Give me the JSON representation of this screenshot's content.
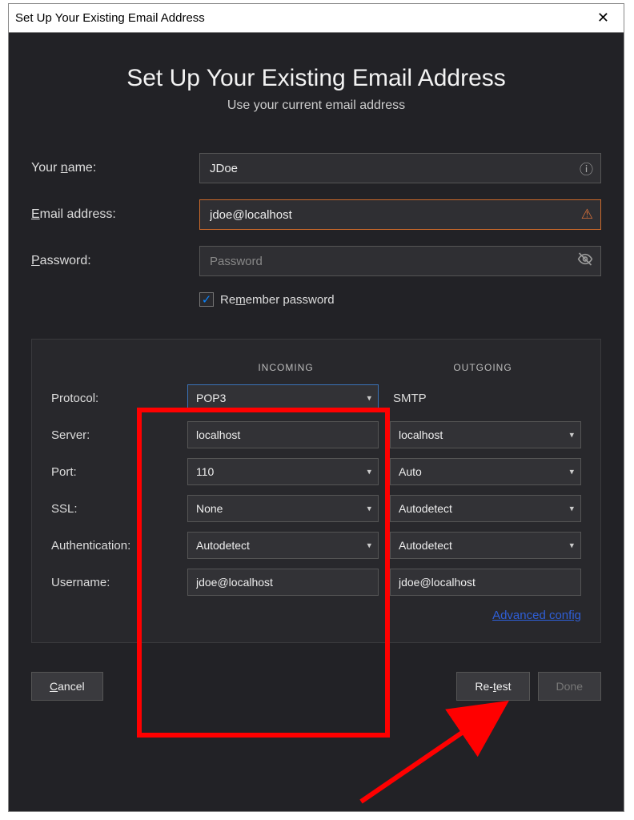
{
  "window": {
    "title": "Set Up Your Existing Email Address"
  },
  "heading": "Set Up Your Existing Email Address",
  "subheading": "Use your current email address",
  "labels": {
    "name": "Your name:",
    "email": "Email address:",
    "password": "Password:",
    "remember": "Remember password",
    "protocol": "Protocol:",
    "server": "Server:",
    "port": "Port:",
    "ssl": "SSL:",
    "auth": "Authentication:",
    "username": "Username:",
    "incoming": "INCOMING",
    "outgoing": "OUTGOING"
  },
  "fields": {
    "name": "JDoe",
    "email": "jdoe@localhost",
    "password": "",
    "password_placeholder": "Password",
    "remember_checked": true
  },
  "incoming": {
    "protocol": "POP3",
    "server": "localhost",
    "port": "110",
    "ssl": "None",
    "auth": "Autodetect",
    "username": "jdoe@localhost"
  },
  "outgoing": {
    "protocol": "SMTP",
    "server": "localhost",
    "port": "Auto",
    "ssl": "Autodetect",
    "auth": "Autodetect",
    "username": "jdoe@localhost"
  },
  "links": {
    "advanced": "Advanced config"
  },
  "buttons": {
    "cancel": "Cancel",
    "retest": "Re-test",
    "done": "Done"
  }
}
